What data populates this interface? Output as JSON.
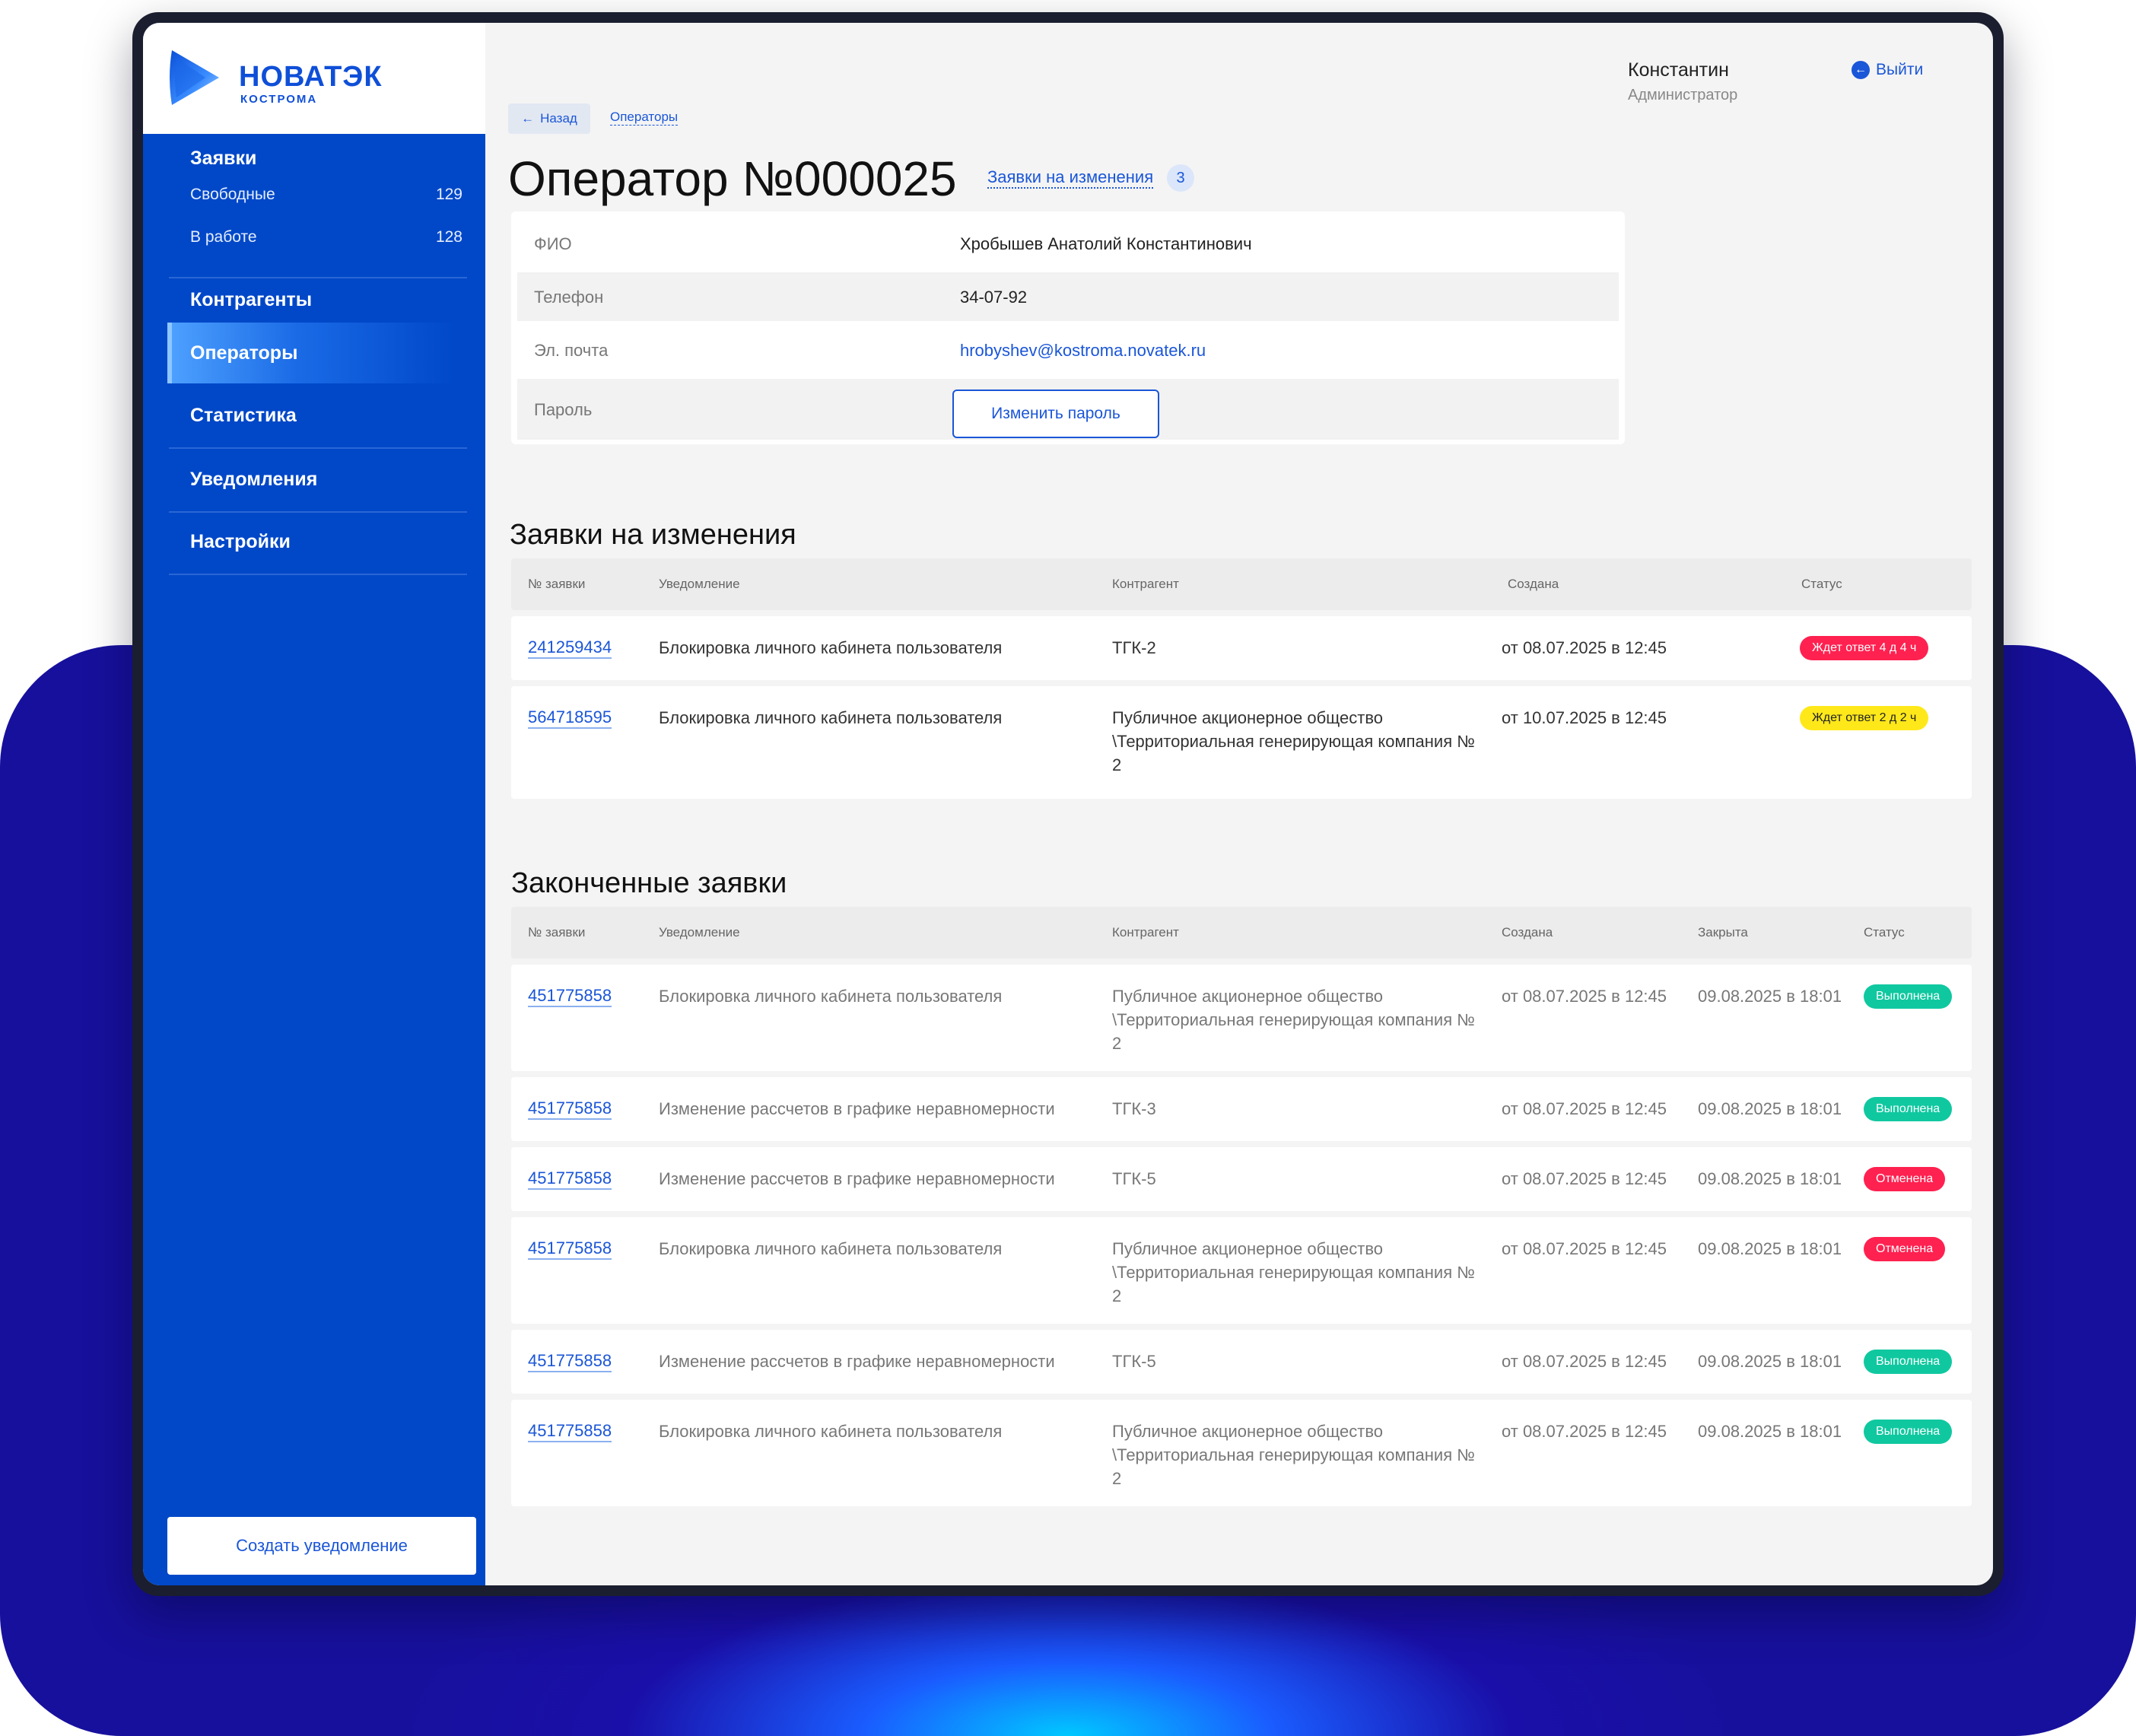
{
  "brand": {
    "name": "НОВАТЭК",
    "city": "КОСТРОМА"
  },
  "sidebar": {
    "requests_title": "Заявки",
    "free_label": "Свободные",
    "free_count": "129",
    "work_label": "В работе",
    "work_count": "128",
    "items": [
      "Контрагенты",
      "Операторы",
      "Статистика",
      "Уведомления",
      "Настройки"
    ],
    "create_button": "Создать уведомление"
  },
  "header": {
    "user_name": "Константин",
    "user_role": "Администратор",
    "logout": "Выйти"
  },
  "breadcrumb": {
    "back": "Назад",
    "current": "Операторы"
  },
  "page": {
    "title": "Оператор №000025",
    "requests_link": "Заявки на изменения",
    "requests_count": "3"
  },
  "info": {
    "fio_label": "ФИО",
    "fio_value": "Хробышев Анатолий Константинович",
    "phone_label": "Телефон",
    "phone_value": "34-07-92",
    "email_label": "Эл. почта",
    "email_value": "hrobyshev@kostroma.novatek.ru",
    "password_label": "Пароль",
    "password_button": "Изменить пароль"
  },
  "pending": {
    "title": "Заявки на изменения",
    "headers": [
      "№ заявки",
      "Уведомление",
      "Контрагент",
      "Создана",
      "Статус"
    ],
    "rows": [
      {
        "id": "241259434",
        "notice": "Блокировка личного кабинета пользователя",
        "counterparty": "ТГК-2",
        "created": "от 08.07.2025 в 12:45",
        "status": "Ждет ответ 4 д  4 ч"
      },
      {
        "id": "564718595",
        "notice": "Блокировка личного кабинета пользователя",
        "counterparty": "Публичное акционерное общество \\Территориальная генерирующая компания № 2",
        "created": "от 10.07.2025 в 12:45",
        "status": "Ждет ответ 2 д 2 ч"
      }
    ]
  },
  "finished": {
    "title": "Законченные заявки",
    "headers": [
      "№ заявки",
      "Уведомление",
      "Контрагент",
      "Создана",
      "Закрыта",
      "Статус"
    ],
    "rows": [
      {
        "id": "451775858",
        "notice": "Блокировка личного кабинета пользователя",
        "counterparty": "Публичное акционерное общество \\Территориальная генерирующая компания № 2",
        "created": "от 08.07.2025 в 12:45",
        "closed": "09.08.2025 в 18:01",
        "status": "Выполнена"
      },
      {
        "id": "451775858",
        "notice": "Изменение рассчетов в графике неравномерности",
        "counterparty": "ТГК-3",
        "created": "от 08.07.2025 в 12:45",
        "closed": "09.08.2025 в 18:01",
        "status": "Выполнена"
      },
      {
        "id": "451775858",
        "notice": "Изменение рассчетов в графике неравномерности",
        "counterparty": "ТГК-5",
        "created": "от 08.07.2025 в 12:45",
        "closed": "09.08.2025 в 18:01",
        "status": "Отменена"
      },
      {
        "id": "451775858",
        "notice": "Блокировка личного кабинета пользователя",
        "counterparty": "Публичное акционерное общество \\Территориальная генерирующая компания № 2",
        "created": "от 08.07.2025 в 12:45",
        "closed": "09.08.2025 в 18:01",
        "status": "Отменена"
      },
      {
        "id": "451775858",
        "notice": "Изменение рассчетов в графике неравномерности",
        "counterparty": "ТГК-5",
        "created": "от 08.07.2025 в 12:45",
        "closed": "09.08.2025 в 18:01",
        "status": "Выполнена"
      },
      {
        "id": "451775858",
        "notice": "Блокировка личного кабинета пользователя",
        "counterparty": "Публичное акционерное общество \\Территориальная генерирующая компания № 2",
        "created": "от 08.07.2025 в 12:45",
        "closed": "09.08.2025 в 18:01",
        "status": "Выполнена"
      }
    ]
  },
  "colors": {
    "accent": "#1a56d8",
    "sidebar": "#0048c8",
    "status_red": "#ff2150",
    "status_yellow": "#ffe81a",
    "status_green": "#10c8a0"
  }
}
